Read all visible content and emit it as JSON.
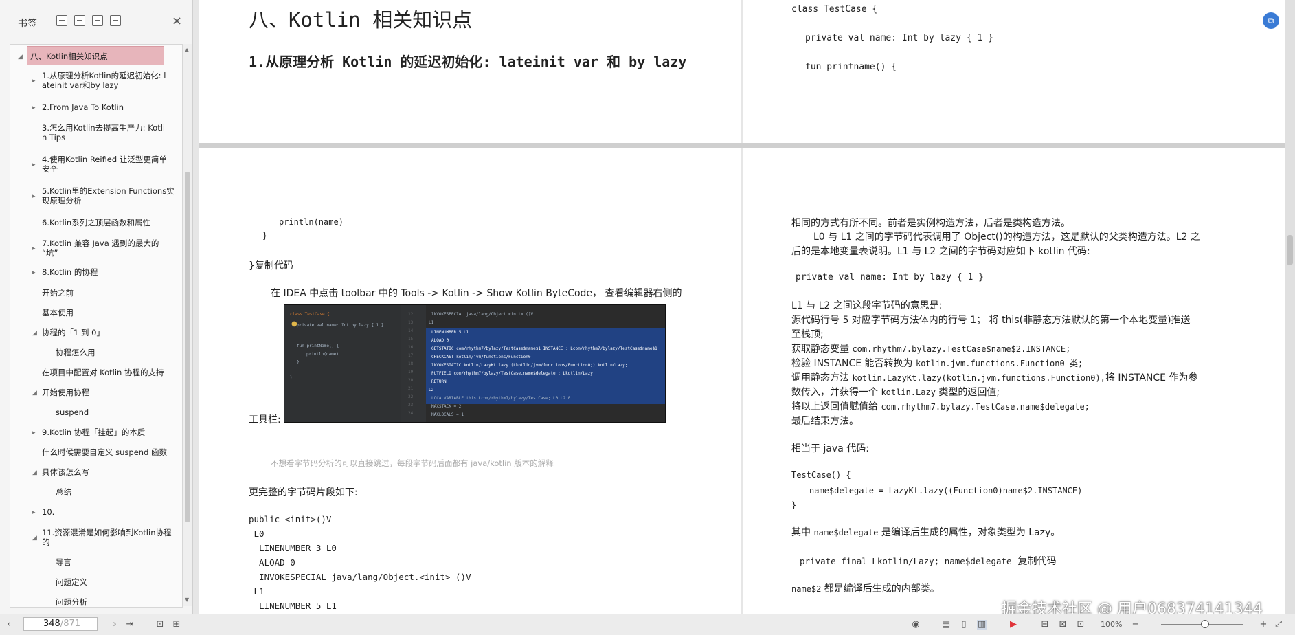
{
  "sidebar": {
    "title": "书签",
    "close_icon": "×",
    "items": [
      {
        "label": "八、Kotlin相关知识点",
        "level": 0,
        "expanded": true,
        "selected": true
      },
      {
        "label": "1.从原理分析Kotlin的延迟初始化: lateinit var和by lazy",
        "line1": "1.从原理分析Kotlin的延迟初始化: l",
        "line2": "ateinit var和by lazy",
        "level": 1,
        "arrow": "right"
      },
      {
        "label": "2.From Java To Kotlin",
        "level": 1,
        "arrow": "right"
      },
      {
        "label": "3.怎么用Kotlin去提高生产力: Kotlin Tips",
        "line1": "3.怎么用Kotlin去提高生产力: Kotli",
        "line2": "n Tips",
        "level": 1,
        "arrow": "none"
      },
      {
        "label": "4.使用Kotlin Reified 让泛型更简单安全",
        "line1": "4.使用Kotlin Reified 让泛型更简单",
        "line2": "安全",
        "level": 1,
        "arrow": "right"
      },
      {
        "label": "5.Kotlin里的Extension Functions实现原理分析",
        "line1": "5.Kotlin里的Extension Functions实",
        "line2": "现原理分析",
        "level": 1,
        "arrow": "right"
      },
      {
        "label": "6.Kotlin系列之顶层函数和属性",
        "level": 1,
        "arrow": "none"
      },
      {
        "label": "7.Kotlin 兼容 Java 遇到的最大的“坑”",
        "line1": "7.Kotlin 兼容 Java 遇到的最大的",
        "line2": "“坑”",
        "level": 1,
        "arrow": "right"
      },
      {
        "label": "8.Kotlin 的协程",
        "level": 1,
        "arrow": "right"
      },
      {
        "label": "开始之前",
        "level": 1,
        "arrow": "none"
      },
      {
        "label": "基本使用",
        "level": 1,
        "arrow": "none"
      },
      {
        "label": "协程的「1 到 0」",
        "level": 1,
        "arrow": "down"
      },
      {
        "label": "协程怎么用",
        "level": 2,
        "arrow": "none"
      },
      {
        "label": "在项目中配置对 Kotlin 协程的支持",
        "level": 1,
        "arrow": "none"
      },
      {
        "label": "开始使用协程",
        "level": 1,
        "arrow": "down"
      },
      {
        "label": "suspend",
        "level": 2,
        "arrow": "none"
      },
      {
        "label": "9.Kotlin 协程「挂起」的本质",
        "level": 1,
        "arrow": "right"
      },
      {
        "label": "什么时候需要自定义 suspend 函数",
        "level": 1,
        "arrow": "none"
      },
      {
        "label": "具体该怎么写",
        "level": 1,
        "arrow": "down"
      },
      {
        "label": "总结",
        "level": 2,
        "arrow": "none"
      },
      {
        "label": "10.",
        "level": 1,
        "arrow": "right"
      },
      {
        "label": "11.资源混淆是如何影响到Kotlin协程的",
        "line1": "11.资源混淆是如何影响到Kotlin协程",
        "line2": "的",
        "level": 1,
        "arrow": "down"
      },
      {
        "label": "导言",
        "level": 2,
        "arrow": "none"
      },
      {
        "label": "问题定义",
        "level": 2,
        "arrow": "none"
      },
      {
        "label": "问题分析",
        "level": 2,
        "arrow": "none"
      }
    ]
  },
  "page_top_left": {
    "heading": "八、Kotlin 相关知识点",
    "subheading": "1.从原理分析 Kotlin 的延迟初始化: lateinit var 和 by lazy"
  },
  "page_top_right": {
    "code": [
      "class TestCase {",
      "private val name: Int by lazy { 1 }",
      "fun printname() {"
    ]
  },
  "page_bottom_left": {
    "code_a": "println(name)",
    "code_b": "}",
    "copy": "}复制代码",
    "para1": "在 IDEA 中点击 toolbar 中的  Tools -> Kotlin -> Show Kotlin ByteCode，   查看编辑器右侧的",
    "toolbar_label": "工具栏:",
    "hint": "不想看字节码分析的可以直接跳过，每段字节码后面都有 java/kotlin 版本的解释",
    "para2": "更完整的字节码片段如下:",
    "bytecode": [
      "public <init>()V",
      " L0",
      "  LINENUMBER 3 L0",
      "  ALOAD 0",
      "  INVOKESPECIAL java/lang/Object.<init> ()V",
      " L1",
      "  LINENUMBER 5 L1"
    ]
  },
  "ide_screenshot": {
    "left": [
      "class TestCase {",
      "private val name: Int by lazy { 1 }",
      "fun printName() {",
      "println(name)",
      "}",
      "}"
    ],
    "right": [
      "INVOKESPECIAL java/lang/Object <init> ()V",
      "L1",
      "LINENUMBER 5 L1",
      "ALOAD 0",
      "GETSTATIC com/rhythm7/bylazy/TestCase$name$1 INSTANCE : Lcom/rhythm7/bylazy/TestCase$name$1",
      "CHECKCAST kotlin/jvm/functions/Function0",
      "INVOKESTATIC kotlin/LazyKt.lazy (Lkotlin/jvm/functions/Function0;)Lkotlin/Lazy;",
      "PUTFIELD com/rhythm7/bylazy/TestCase.name$delegate : Lkotlin/Lazy;",
      "RETURN",
      "L2",
      "LOCALVARIABLE this Lcom/rhythm7/bylazy/TestCase; L0 L2 0",
      "MAXSTACK = 2",
      "MAXLOCALS = 1"
    ],
    "line_numbers": [
      "12",
      "13",
      "14",
      "15",
      "16",
      "17",
      "18",
      "19",
      "20",
      "21",
      "22",
      "23",
      "24"
    ]
  },
  "page_bottom_right": {
    "l1": "相同的方式有所不同。前者是实例构造方法，后者是类构造方法。",
    "l2": "L0 与 L1 之间的字节码代表调用了 Object()的构造方法，这是默认的父类构造方法。L2 之",
    "l3": "后的是本地变量表说明。L1 与 L2 之间的字节码对应如下 kotlin 代码:",
    "code1": "private val name: Int by lazy { 1 }",
    "l4": "L1 与 L2 之间这段字节码的意思是:",
    "l5": "源代码行号 5 对应字节码方法体内的行号 1；  将 this(非静态方法默认的第一个本地变量)推送",
    "l6": "至栈顶;",
    "l7a": "获取静态变量 ",
    "l7b": "com.rhythm7.bylazy.TestCase$name$2.INSTANCE;",
    "l8a": "检验 INSTANCE 能否转换为 ",
    "l8b": "kotlin.jvm.functions.Function0 类;",
    "l9a": "调用静态方法 ",
    "l9b": "kotlin.LazyKt.lazy(kotlin.jvm.functions.Function0),",
    "l9c": "将 INSTANCE 作为参",
    "l10a": "数传入，并获得一个 ",
    "l10b": "kotlin.Lazy",
    "l10c": " 类型的返回值;",
    "l11a": "将以上返回值赋值给 ",
    "l11b": "com.rhythm7.bylazy.TestCase.name$delegate;",
    "l12": "最后结束方法。",
    "l13": "相当于 java 代码:",
    "java1": "TestCase() {",
    "java2": "name$delegate = LazyKt.lazy((Function0)name$2.INSTANCE)",
    "java3": "}",
    "l14a": "其中 ",
    "l14b": "name$delegate",
    "l14c": " 是编译后生成的属性，对象类型为 Lazy。",
    "code2": "private final Lkotlin/Lazy; name$delegate",
    "code2b": "复制代码",
    "l15a": "name$2",
    "l15b": " 都是编译后生成的内部类。"
  },
  "bottombar": {
    "current_page": "348",
    "total_pages": "/871",
    "zoom": "100%"
  },
  "watermark": "掘金技术社区 @ 用户068374141344",
  "colors": {
    "selected_bookmark": "#e7b5bb",
    "accent": "#3a7bd5",
    "ide_selection": "#214283"
  }
}
